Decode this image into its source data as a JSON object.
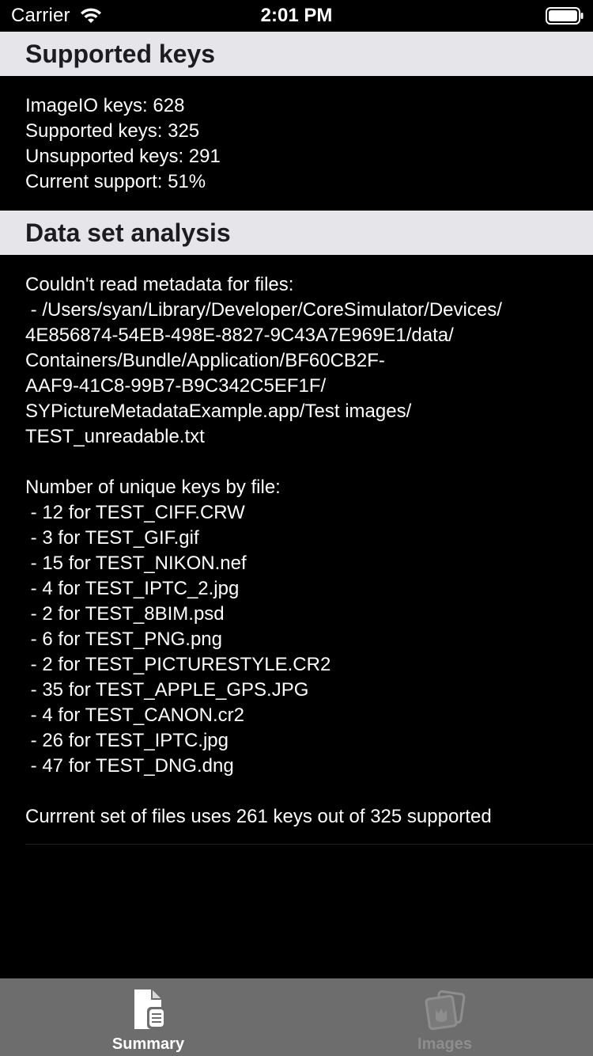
{
  "status_bar": {
    "carrier": "Carrier",
    "time": "2:01 PM",
    "wifi_icon": "wifi-icon",
    "battery_icon": "battery-icon"
  },
  "sections": [
    {
      "title": "Supported keys",
      "lines": [
        "ImageIO keys: 628",
        "Supported keys: 325",
        "Unsupported keys: 291",
        "Current support: 51%"
      ]
    },
    {
      "title": "Data set analysis",
      "lines": [
        "Couldn't read metadata for files:",
        " - /Users/syan/Library/Developer/CoreSimulator/Devices/",
        "4E856874-54EB-498E-8827-9C43A7E969E1/data/",
        "Containers/Bundle/Application/BF60CB2F-",
        "AAF9-41C8-99B7-B9C342C5EF1F/",
        "SYPictureMetadataExample.app/Test images/",
        "TEST_unreadable.txt",
        "",
        "Number of unique keys by file:",
        " - 12 for TEST_CIFF.CRW",
        " - 3 for TEST_GIF.gif",
        " - 15 for TEST_NIKON.nef",
        " - 4 for TEST_IPTC_2.jpg",
        " - 2 for TEST_8BIM.psd",
        " - 6 for TEST_PNG.png",
        " - 2 for TEST_PICTURESTYLE.CR2",
        " - 35 for TEST_APPLE_GPS.JPG",
        " - 4 for TEST_CANON.cr2",
        " - 26 for TEST_IPTC.jpg",
        " - 47 for TEST_DNG.dng",
        "",
        "Currrent set of files uses 261 keys out of 325 supported"
      ]
    }
  ],
  "tabs": [
    {
      "label": "Summary",
      "icon": "document-icon",
      "selected": true
    },
    {
      "label": "Images",
      "icon": "photos-icon",
      "selected": false
    }
  ],
  "colors": {
    "header_bg": "#e5e5ea",
    "tab_bar_bg": "#6d6d6d",
    "tab_selected": "#ffffff",
    "tab_unselected": "#8e8e8e"
  }
}
